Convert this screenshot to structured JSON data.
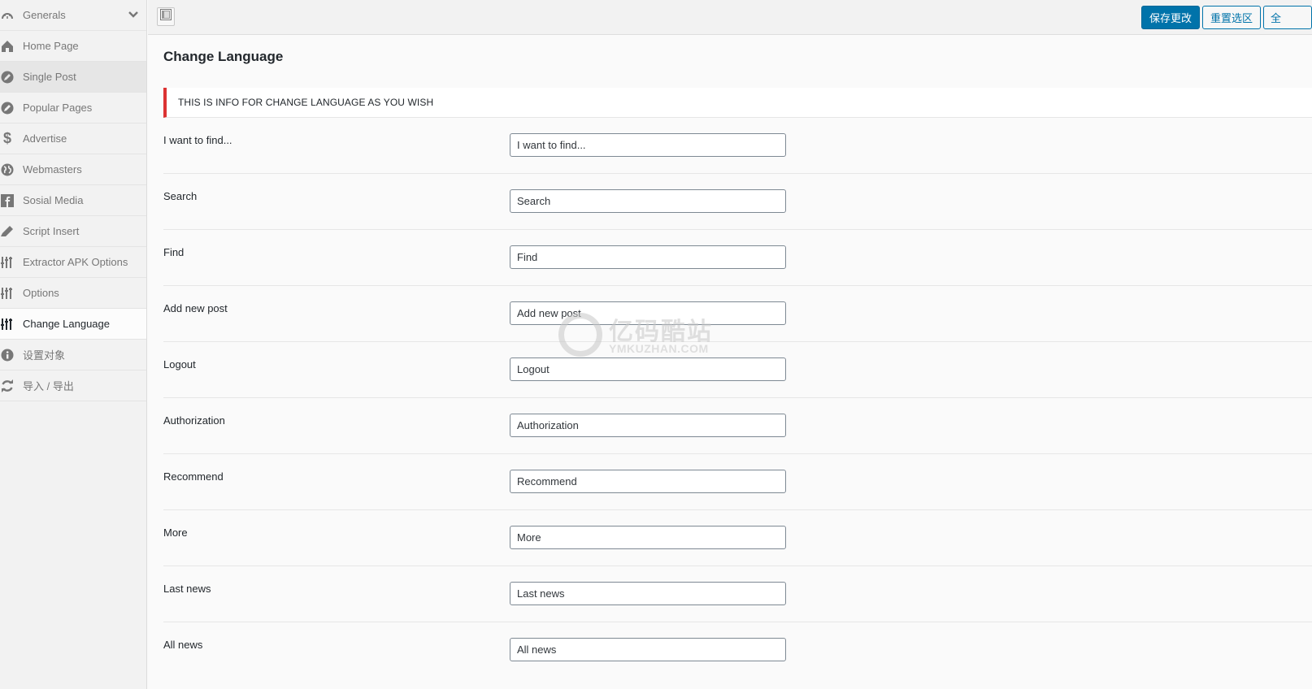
{
  "sidebar": {
    "items": [
      {
        "label": "Generals",
        "icon": "dashboard-gauge-icon",
        "state": "normal",
        "has_chevron": true
      },
      {
        "label": "Home Page",
        "icon": "home-icon",
        "state": "normal"
      },
      {
        "label": "Single Post",
        "icon": "pencil-circle-icon",
        "state": "hover"
      },
      {
        "label": "Popular Pages",
        "icon": "pencil-circle-icon",
        "state": "normal"
      },
      {
        "label": "Advertise",
        "icon": "dollar-icon",
        "state": "normal"
      },
      {
        "label": "Webmasters",
        "icon": "globe-icon",
        "state": "normal"
      },
      {
        "label": "Sosial Media",
        "icon": "facebook-icon",
        "state": "normal"
      },
      {
        "label": "Script Insert",
        "icon": "pencil-icon",
        "state": "normal"
      },
      {
        "label": "Extractor APK Options",
        "icon": "sliders-icon",
        "state": "normal"
      },
      {
        "label": "Options",
        "icon": "sliders-icon",
        "state": "normal"
      },
      {
        "label": "Change Language",
        "icon": "sliders-icon",
        "state": "active"
      },
      {
        "label": "设置对象",
        "icon": "info-icon",
        "state": "normal"
      },
      {
        "label": "导入 / 导出",
        "icon": "refresh-icon",
        "state": "normal"
      }
    ]
  },
  "toolbar": {
    "save_label": "保存更改",
    "reset_section_label": "重置选区",
    "reset_all_label": "全"
  },
  "page": {
    "title": "Change Language",
    "info": "THIS IS INFO FOR CHANGE LANGUAGE AS YOU WISH"
  },
  "fields": [
    {
      "label": "I want to find...",
      "value": "I want to find..."
    },
    {
      "label": "Search",
      "value": "Search"
    },
    {
      "label": "Find",
      "value": "Find"
    },
    {
      "label": "Add new post",
      "value": "Add new post"
    },
    {
      "label": "Logout",
      "value": "Logout"
    },
    {
      "label": "Authorization",
      "value": "Authorization"
    },
    {
      "label": "Recommend",
      "value": "Recommend"
    },
    {
      "label": "More",
      "value": "More"
    },
    {
      "label": "Last news",
      "value": "Last news"
    },
    {
      "label": "All news",
      "value": "All news"
    }
  ],
  "watermark": {
    "cn": "亿码酷站",
    "en": "YMKUZHAN.COM"
  },
  "colors": {
    "primary": "#0073aa",
    "info_border": "#dc3232"
  }
}
